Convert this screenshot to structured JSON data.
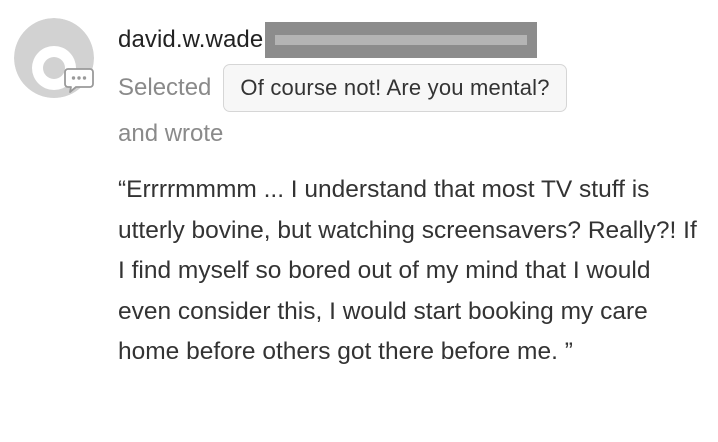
{
  "comment": {
    "username": "david.w.wade",
    "selected_prefix": "Selected",
    "selected_choice": "Of course not! Are you mental?",
    "wrote_label": "and wrote",
    "quote_text": "“Errrrmmmm ... I understand that most TV stuff is utterly bovine, but watching screensavers? Really?! If I find myself so bored out of my mind that I would even consider this, I would start booking my care home before others got there before me. ”"
  },
  "icons": {
    "avatar": "default-user-avatar-icon",
    "badge": "comment-bubble-icon"
  },
  "colors": {
    "avatar_bg": "#d2d2d2",
    "avatar_fg": "#ffffff",
    "muted_text": "#8a8a8a",
    "redaction": "#8c8c8c"
  }
}
